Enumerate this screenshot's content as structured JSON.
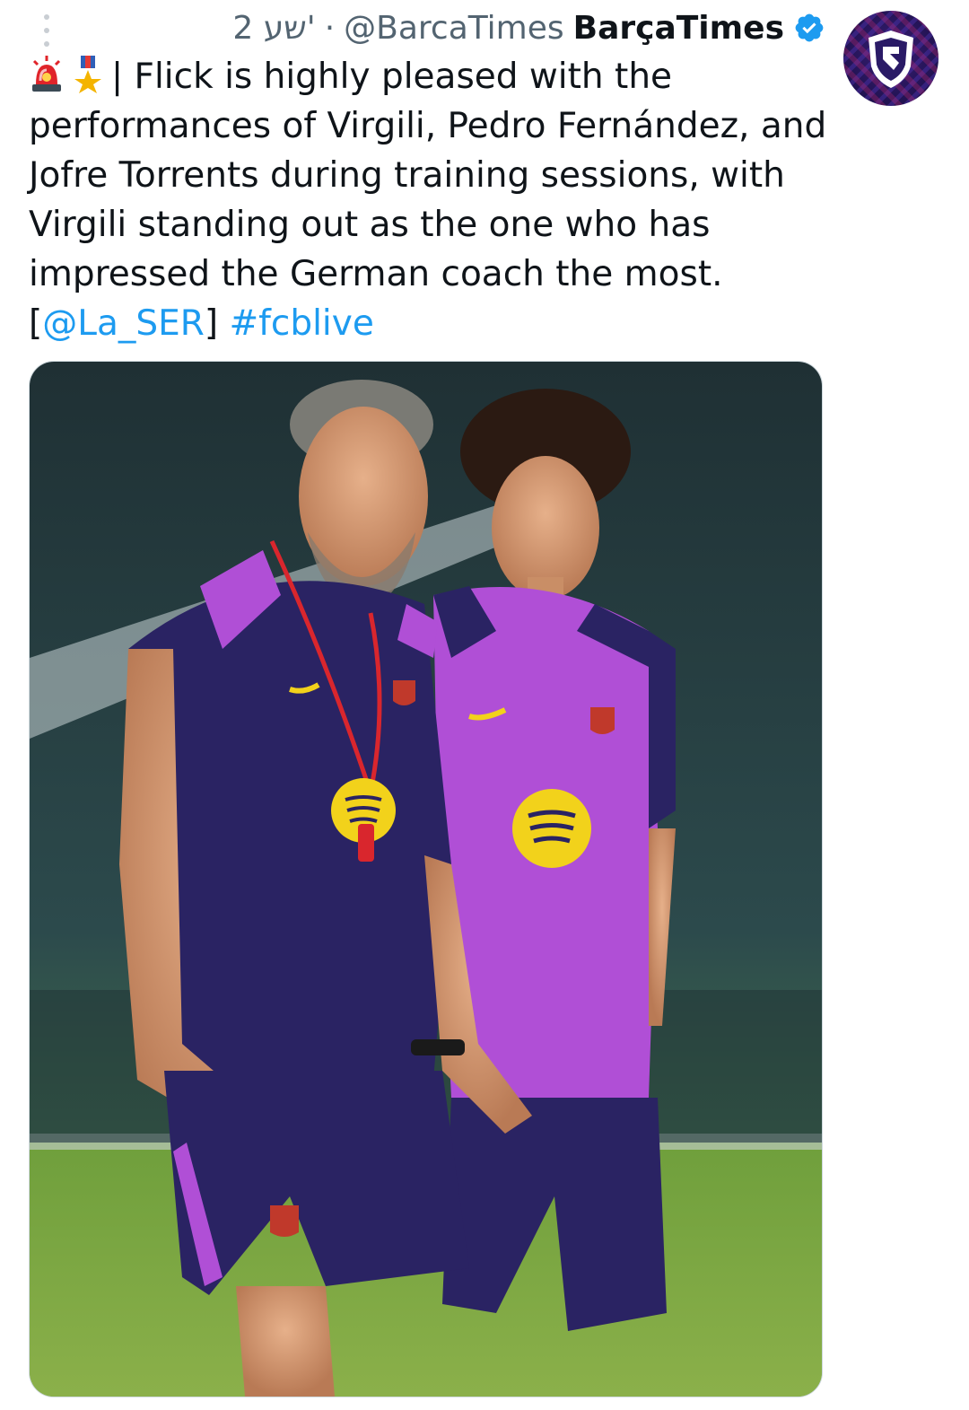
{
  "tweet": {
    "display_name": "BarçaTimes",
    "handle": "@BarcaTimes",
    "separator": "·",
    "time": "2 שע'",
    "text_lines": [
      "| Flick is highly pleased with the",
      "performances of Virgili, Pedro Fernández, and",
      "Jofre Torrents during training sessions, with",
      "Virgili standing out as the one who has",
      "impressed the German coach the most."
    ],
    "source_open": "[",
    "source_mention": "@La_SER",
    "source_close": "]",
    "hashtag": "#fcblive"
  },
  "icons": {
    "more": "more-vertical-icon",
    "verified": "verified-badge-icon",
    "siren": "police-light-emoji-icon",
    "medal": "military-medal-emoji-icon"
  },
  "colors": {
    "link": "#1d9bf0",
    "verified": "#1d9bf0",
    "secondary_text": "#536471",
    "primary_text": "#0f1419",
    "kit_navy": "#2a2363",
    "kit_magenta": "#b04fd6",
    "sponsor_yellow": "#f2d21b"
  }
}
